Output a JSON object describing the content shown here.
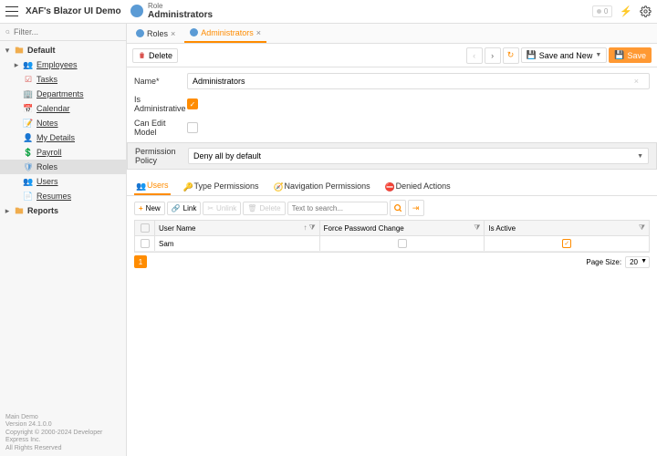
{
  "app": {
    "title": "XAF's Blazor UI Demo"
  },
  "header": {
    "type_label": "Role",
    "name": "Administrators",
    "badge_count": "0"
  },
  "sidebar": {
    "search_placeholder": "Filter...",
    "groups": {
      "default": "Default",
      "reports": "Reports"
    },
    "items": {
      "employees": "Employees",
      "tasks": "Tasks",
      "departments": "Departments",
      "calendar": "Calendar",
      "notes": "Notes",
      "mydetails": "My Details",
      "payroll": "Payroll",
      "roles": "Roles",
      "users": "Users",
      "resumes": "Resumes"
    }
  },
  "tabs": {
    "roles": "Roles",
    "admins": "Administrators"
  },
  "toolbar": {
    "delete": "Delete",
    "save_and_new": "Save and New",
    "save": "Save"
  },
  "form": {
    "name_label": "Name*",
    "name_value": "Administrators",
    "is_admin_label": "Is Administrative",
    "can_edit_label": "Can Edit Model",
    "policy_label": "Permission Policy",
    "policy_value": "Deny all by default"
  },
  "inner_tabs": {
    "users": "Users",
    "type_perm": "Type Permissions",
    "nav_perm": "Navigation Permissions",
    "denied": "Denied Actions"
  },
  "grid_toolbar": {
    "new": "New",
    "link": "Link",
    "unlink": "Unlink",
    "delete": "Delete",
    "search_placeholder": "Text to search..."
  },
  "grid": {
    "headers": {
      "user": "User Name",
      "force": "Force Password Change",
      "active": "Is Active"
    },
    "rows": [
      {
        "user": "Sam",
        "force": false,
        "active": true
      }
    ]
  },
  "pager": {
    "page": "1",
    "size_label": "Page Size:",
    "size_value": "20"
  },
  "footer": {
    "l1": "Main Demo",
    "l2": "Version 24.1.0.0",
    "l3": "Copyright © 2000-2024 Developer Express Inc.",
    "l4": "All Rights Reserved"
  }
}
